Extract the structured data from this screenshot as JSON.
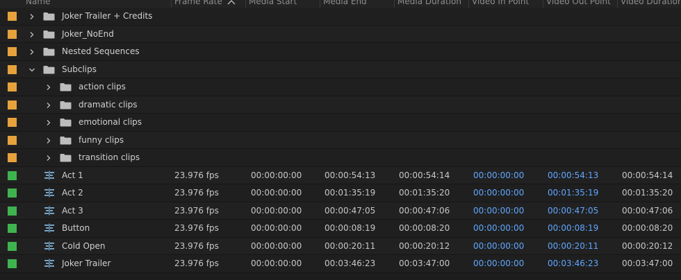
{
  "colors": {
    "folder_label": "#e6a23c",
    "sequence_label": "#3fb34f",
    "timecode_link": "#61a7ff"
  },
  "columns": [
    {
      "key": "name",
      "label": "Name"
    },
    {
      "key": "frame_rate",
      "label": "Frame Rate"
    },
    {
      "key": "media_start",
      "label": "Media Start"
    },
    {
      "key": "media_end",
      "label": "Media End"
    },
    {
      "key": "media_duration",
      "label": "Media Duration"
    },
    {
      "key": "video_in",
      "label": "Video In Point"
    },
    {
      "key": "video_out",
      "label": "Video Out Point"
    },
    {
      "key": "video_duration",
      "label": "Video Duration"
    }
  ],
  "sort_icon": "chevron-up-icon",
  "bins": [
    {
      "name": "Joker Trailer + Credits",
      "expanded": false,
      "level": 0
    },
    {
      "name": "Joker_NoEnd",
      "expanded": false,
      "level": 0
    },
    {
      "name": "Nested Sequences",
      "expanded": false,
      "level": 0
    },
    {
      "name": "Subclips",
      "expanded": true,
      "level": 0
    },
    {
      "name": "action clips",
      "expanded": false,
      "level": 1
    },
    {
      "name": "dramatic clips",
      "expanded": false,
      "level": 1
    },
    {
      "name": "emotional clips",
      "expanded": false,
      "level": 1
    },
    {
      "name": "funny clips",
      "expanded": false,
      "level": 1
    },
    {
      "name": "transition clips",
      "expanded": false,
      "level": 1
    }
  ],
  "sequences": [
    {
      "name": "Act 1",
      "frame_rate": "23.976 fps",
      "media_start": "00:00:00:00",
      "media_end": "00:00:54:13",
      "media_duration": "00:00:54:14",
      "video_in": "00:00:00:00",
      "video_out": "00:00:54:13",
      "video_duration": "00:00:54:14"
    },
    {
      "name": "Act 2",
      "frame_rate": "23.976 fps",
      "media_start": "00:00:00:00",
      "media_end": "00:01:35:19",
      "media_duration": "00:01:35:20",
      "video_in": "00:00:00:00",
      "video_out": "00:01:35:19",
      "video_duration": "00:01:35:20"
    },
    {
      "name": "Act 3",
      "frame_rate": "23.976 fps",
      "media_start": "00:00:00:00",
      "media_end": "00:00:47:05",
      "media_duration": "00:00:47:06",
      "video_in": "00:00:00:00",
      "video_out": "00:00:47:05",
      "video_duration": "00:00:47:06"
    },
    {
      "name": "Button",
      "frame_rate": "23.976 fps",
      "media_start": "00:00:00:00",
      "media_end": "00:00:08:19",
      "media_duration": "00:00:08:20",
      "video_in": "00:00:00:00",
      "video_out": "00:00:08:19",
      "video_duration": "00:00:08:20"
    },
    {
      "name": "Cold Open",
      "frame_rate": "23.976 fps",
      "media_start": "00:00:00:00",
      "media_end": "00:00:20:11",
      "media_duration": "00:00:20:12",
      "video_in": "00:00:00:00",
      "video_out": "00:00:20:11",
      "video_duration": "00:00:20:12"
    },
    {
      "name": "Joker Trailer",
      "frame_rate": "23.976 fps",
      "media_start": "00:00:00:00",
      "media_end": "00:03:46:23",
      "media_duration": "00:03:47:00",
      "video_in": "00:00:00:00",
      "video_out": "00:03:46:23",
      "video_duration": "00:03:47:00"
    }
  ]
}
